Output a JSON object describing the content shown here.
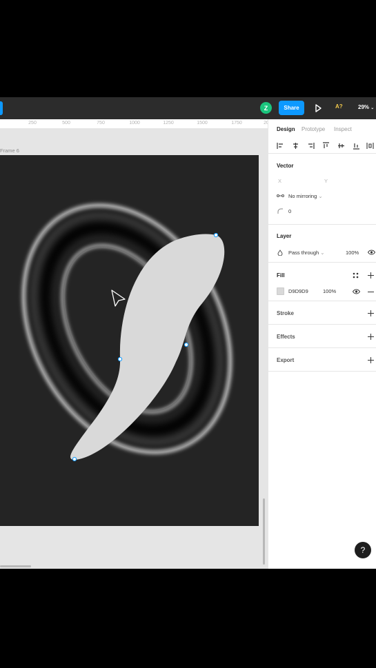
{
  "toolbar": {
    "avatar_initial": "Z",
    "share_label": "Share",
    "a_label": "A?",
    "zoom_label": "29%"
  },
  "ruler": {
    "ticks": [
      "250",
      "500",
      "750",
      "1000",
      "1250",
      "1500",
      "1750",
      "20"
    ]
  },
  "canvas": {
    "frame_label": "Frame 6"
  },
  "panel": {
    "tabs": [
      "Design",
      "Prototype",
      "Inspect"
    ],
    "vector": {
      "title": "Vector",
      "x_label": "X",
      "y_label": "Y",
      "mirroring": "No mirroring",
      "corner_radius": "0"
    },
    "layer": {
      "title": "Layer",
      "blend_mode": "Pass through",
      "opacity": "100%"
    },
    "fill": {
      "title": "Fill",
      "hex": "D9D9D9",
      "opacity": "100%",
      "swatch_color": "#d9d9d9"
    },
    "stroke": {
      "title": "Stroke"
    },
    "effects": {
      "title": "Effects"
    },
    "export": {
      "title": "Export"
    }
  },
  "colors": {
    "accent": "#0d99ff",
    "avatar": "#1bc47d",
    "frame_bg": "#242424",
    "shape": "#d9d9d9"
  },
  "help": "?"
}
